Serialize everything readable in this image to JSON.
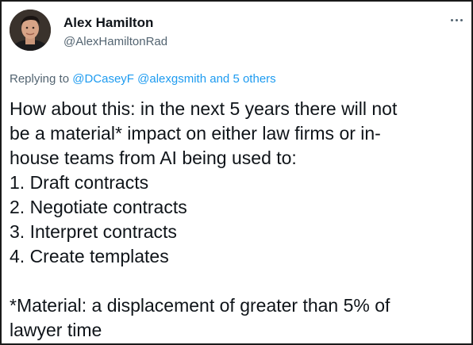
{
  "author": {
    "name": "Alex Hamilton",
    "handle": "@AlexHamiltonRad"
  },
  "reply_context": {
    "prefix": "Replying to ",
    "mention_1": "@DCaseyF",
    "mention_2": "@alexgsmith",
    "connector": " and ",
    "others": "5 others"
  },
  "tweet": {
    "line_1": "How about this: in the next 5 years there will not",
    "line_2": "be a material* impact on either law firms or in-",
    "line_3": "house teams from AI being used to:",
    "list": [
      "1. Draft contracts",
      "2. Negotiate contracts",
      "3. Interpret contracts",
      "4. Create templates"
    ],
    "footnote_1": "*Material: a displacement of greater than 5% of",
    "footnote_2": "lawyer time"
  },
  "icons": {
    "menu": "more-horizontal-icon",
    "avatar": "profile-photo"
  },
  "colors": {
    "link": "#1d9bf0",
    "secondary_text": "#536471",
    "primary_text": "#0f1419"
  }
}
